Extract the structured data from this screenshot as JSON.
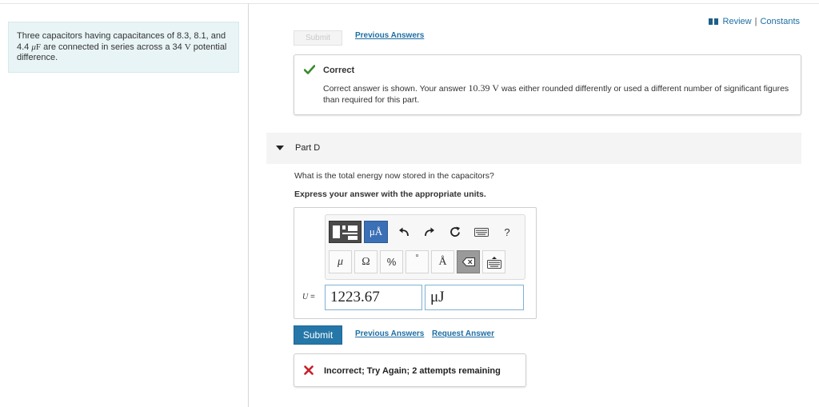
{
  "problem": {
    "part1": "Three capacitors having capacitances of 8.3, 8.1, and 4.4 ",
    "mu": "μ",
    "F": "F",
    "part2": " are connected in series across a 34 ",
    "V": "V",
    "part3": " potential difference."
  },
  "header": {
    "review": "Review",
    "separator": "|",
    "constants": "Constants"
  },
  "top_actions": {
    "submit_label": "Submit",
    "previous_answers": "Previous Answers"
  },
  "feedback_correct": {
    "title": "Correct",
    "text_before": "Correct answer is shown. Your answer ",
    "answer_value": "10.39",
    "answer_unit": "V",
    "text_after": " was either rounded differently or used a different number of significant figures than required for this part."
  },
  "part": {
    "label": "Part D",
    "question": "What is the total energy now stored in the capacitors?",
    "instruction": "Express your answer with the appropriate units."
  },
  "editor": {
    "units_button": "μÅ",
    "help_label": "?",
    "symbols": [
      "μ",
      "Ω",
      "%",
      "°",
      "Å"
    ],
    "variable": "U",
    "equals": "=",
    "value": "1223.67",
    "unit": "μJ"
  },
  "bottom_actions": {
    "submit_label": "Submit",
    "previous_answers": "Previous Answers",
    "request_answer": "Request Answer"
  },
  "feedback_incorrect": {
    "text": "Incorrect; Try Again; 2 attempts remaining"
  },
  "colors": {
    "link": "#1e6ea3",
    "submit": "#2577a8",
    "correct_check": "#3a8a2e",
    "incorrect_x": "#c8202a",
    "problem_bg": "#e8f4f5"
  }
}
